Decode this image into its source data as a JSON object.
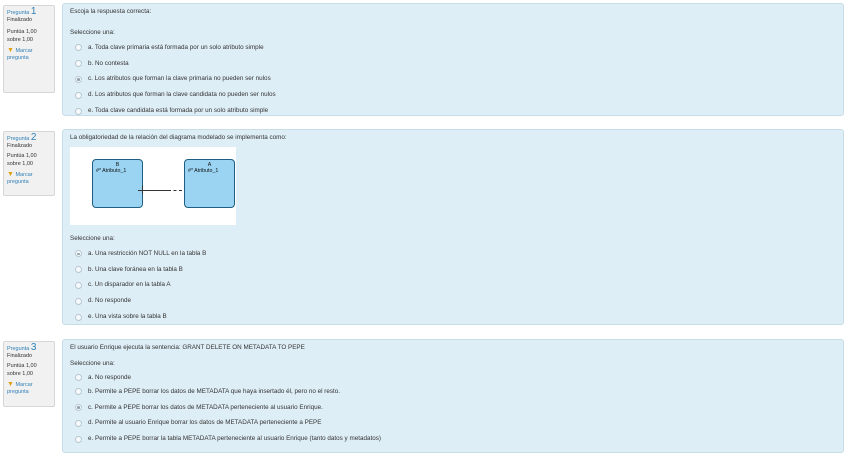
{
  "questions": [
    {
      "label": "Pregunta",
      "number": "1",
      "state": "Finalizado",
      "score": "Puntúa 1,00 sobre 1,00",
      "flag": "Marcar pregunta",
      "text": "Escoja la respuesta correcta:",
      "prompt": "Seleccione una:",
      "options": [
        {
          "text": "a. Toda clave primaria está formada por un solo atributo simple",
          "selected": false
        },
        {
          "text": "b. No contesta",
          "selected": false
        },
        {
          "text": "c. Los atributos que forman la clave primaria no pueden ser nulos",
          "selected": true
        },
        {
          "text": "d. Los atributos que forman la clave candidata no pueden ser nulos",
          "selected": false
        },
        {
          "text": "e. Toda clave candidata está formada por un solo atributo simple",
          "selected": false
        }
      ]
    },
    {
      "label": "Pregunta",
      "number": "2",
      "state": "Finalizado",
      "score": "Puntúa 1,00 sobre 1,00",
      "flag": "Marcar pregunta",
      "text": "La obligatoriedad de la relación del diagrama modelado se implementa como:",
      "diagram": {
        "entity_b": {
          "name": "B",
          "attr": "#* Atributo_1"
        },
        "entity_a": {
          "name": "A",
          "attr": "#* Atributo_1"
        }
      },
      "prompt": "Seleccione una:",
      "options": [
        {
          "text": "a. Una restricción NOT NULL en la tabla B",
          "selected": true
        },
        {
          "text": "b. Una clave foránea en la tabla B",
          "selected": false
        },
        {
          "text": "c. Un disparador en la tabla A",
          "selected": false
        },
        {
          "text": "d. No responde",
          "selected": false
        },
        {
          "text": "e. Una vista sobre la tabla B",
          "selected": false
        }
      ]
    },
    {
      "label": "Pregunta",
      "number": "3",
      "state": "Finalizado",
      "score": "Puntúa 1,00 sobre 1,00",
      "flag": "Marcar pregunta",
      "text": "El usuario Enrique ejecuta la sentencia: GRANT DELETE ON METADATA TO PEPE",
      "prompt": "Seleccione una:",
      "options": [
        {
          "text": "a. No responde",
          "selected": false
        },
        {
          "text": "b. Permite a PEPE borrar los datos de METADATA que haya insertado él, pero no el resto.",
          "selected": false
        },
        {
          "text": "c. Permite a PEPE borrar los datos de METADATA perteneciente al usuario Enrique.",
          "selected": true
        },
        {
          "text": "d. Permite al usuario Enrique borrar los datos de METADATA perteneciente a PEPE",
          "selected": false
        },
        {
          "text": "e. Permite a PEPE borrar la tabla METADATA perteneciente al usuario Enrique (tanto datos y metadatos)",
          "selected": false
        }
      ]
    }
  ]
}
